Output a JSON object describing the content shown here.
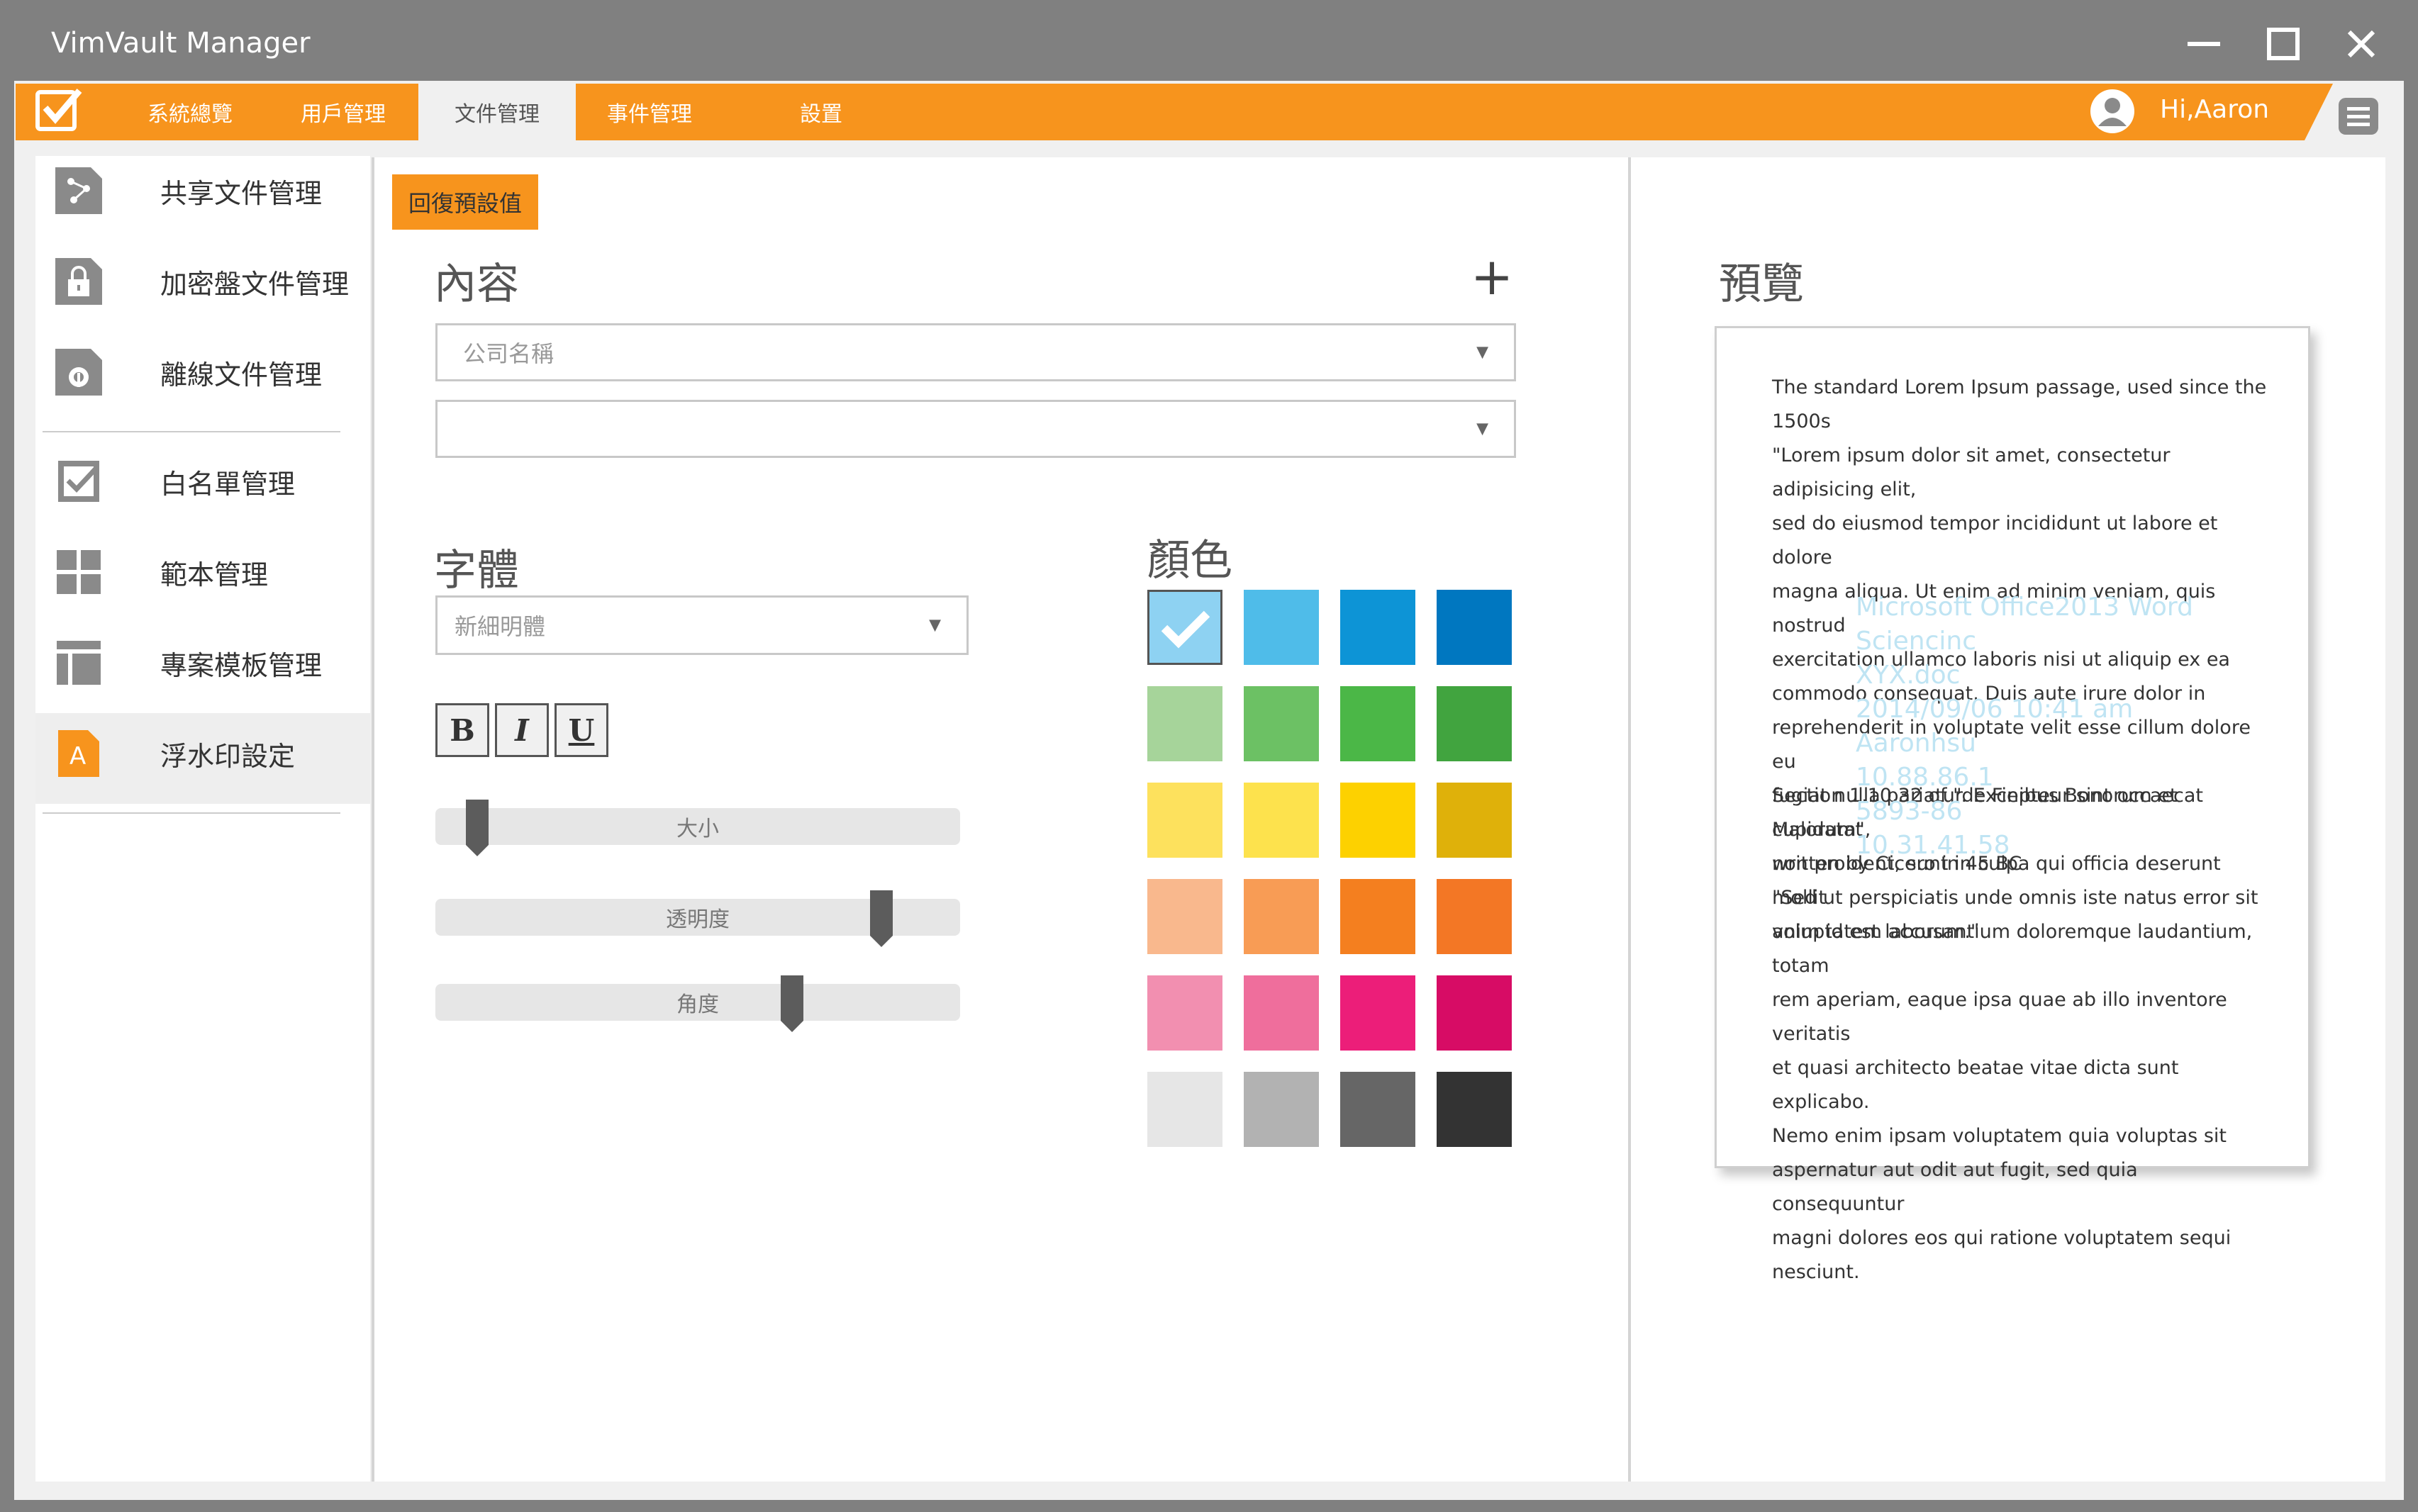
{
  "window": {
    "title": "VimVault Manager",
    "controls": [
      "minimize",
      "maximize",
      "close"
    ]
  },
  "menubar": {
    "items": [
      {
        "label": "系統總覽"
      },
      {
        "label": "用戶管理"
      },
      {
        "label": "文件管理"
      },
      {
        "label": "事件管理"
      },
      {
        "label": "設置"
      }
    ],
    "active_index": 2,
    "greeting": "Hi,Aaron",
    "accent_color": "#f7941d"
  },
  "sidebar": {
    "items": [
      {
        "label": "共享文件管理",
        "icon": "share-icon"
      },
      {
        "label": "加密盤文件管理",
        "icon": "lock-icon"
      },
      {
        "label": "離線文件管理",
        "icon": "offline-icon"
      },
      {
        "label": "白名單管理",
        "icon": "checkbox-icon"
      },
      {
        "label": "範本管理",
        "icon": "grid-icon"
      },
      {
        "label": "專案模板管理",
        "icon": "layout-icon"
      },
      {
        "label": "浮水印設定",
        "icon": "text-a-icon"
      }
    ],
    "active_index": 6
  },
  "editor": {
    "reset_label": "回復預設值",
    "content_title": "內容",
    "add_label": "+",
    "content_select_1": "公司名稱",
    "content_select_2": "",
    "font_title": "字體",
    "font_value": "新細明體",
    "bold_label": "B",
    "italic_label": "I",
    "underline_label": "U",
    "sliders": [
      {
        "label": "大小",
        "value": 0.08
      },
      {
        "label": "透明度",
        "value": 0.85
      },
      {
        "label": "角度",
        "value": 0.68
      }
    ],
    "color_title": "顏色",
    "colors": [
      [
        "#8ed2f2",
        "#4fbce9",
        "#0d94d6",
        "#0077c0"
      ],
      [
        "#a6d49a",
        "#6cc164",
        "#4bb747",
        "#41a43f"
      ],
      [
        "#fde15d",
        "#fde24d",
        "#fdd100",
        "#dfb10a"
      ],
      [
        "#f9b88d",
        "#f89c55",
        "#f47f1f",
        "#f37725"
      ],
      [
        "#f28fb0",
        "#ef6e9c",
        "#ec1e79",
        "#d70c65"
      ],
      [
        "#e6e6e6",
        "#b2b2b2",
        "#666666",
        "#333333"
      ]
    ],
    "selected_color": "#8ed2f2"
  },
  "preview": {
    "title": "預覽",
    "paragraphs": [
      "The standard Lorem Ipsum passage, used since the 1500s",
      "\"Lorem ipsum dolor sit amet, consectetur adipisicing elit,\nsed do eiusmod tempor incididunt ut labore et dolore\nmagna aliqua. Ut enim ad minim veniam, quis nostrud\nexercitation ullamco laboris nisi ut aliquip ex ea\ncommodo consequat. Duis aute irure dolor in\nreprehenderit in voluptate velit esse cillum dolore eu\nfugiat nulla pariatur. Excepteur sint occaecat cupidatat\nnon proident, sunt in culpa qui officia deserunt mollit\nanim id est laborum.\"",
      "Section 1.10.32 of \"de Finibus Bonorum et Malorum\",\nwritten by Cicero in 45 BC",
      "\"Sed ut perspiciatis unde omnis iste natus error sit\nvoluptatem accusantium doloremque laudantium, totam\nrem aperiam, eaque ipsa quae ab illo inventore veritatis\net quasi architecto beatae vitae dicta sunt explicabo.\nNemo enim ipsam voluptatem quia voluptas sit\naspernatur aut odit aut fugit, sed quia consequuntur\nmagni dolores eos qui ratione voluptatem sequi nesciunt."
    ],
    "watermark": "Microsoft Office2013 Word\nSciencinc\nXYX.doc\n2014/09/06 10:41 am\nAaronhsu\n10.88.86.1\n5893-86\n10.31.41.58",
    "watermark_color": "#bfe4f3"
  }
}
